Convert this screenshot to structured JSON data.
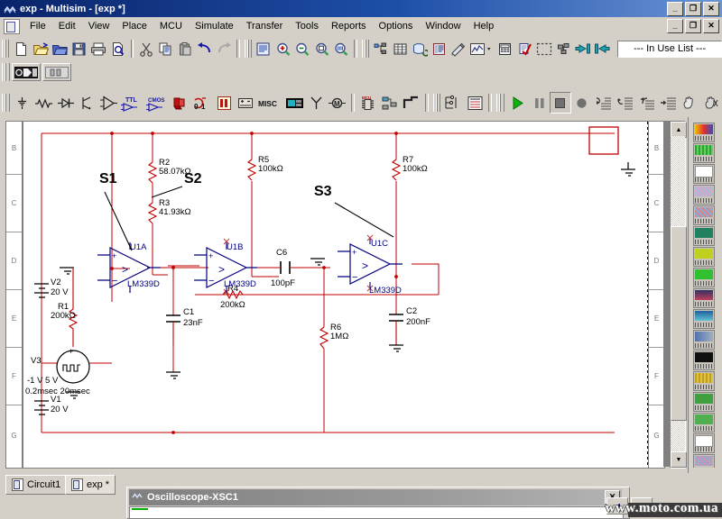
{
  "window": {
    "title": "exp - Multisim - [exp *]",
    "icon": "multisim-icon",
    "minimize": "_",
    "restore": "❐",
    "close": "✕"
  },
  "menu": {
    "items": [
      {
        "label": "File"
      },
      {
        "label": "Edit"
      },
      {
        "label": "View"
      },
      {
        "label": "Place"
      },
      {
        "label": "MCU"
      },
      {
        "label": "Simulate"
      },
      {
        "label": "Transfer"
      },
      {
        "label": "Tools"
      },
      {
        "label": "Reports"
      },
      {
        "label": "Options"
      },
      {
        "label": "Window"
      },
      {
        "label": "Help"
      }
    ],
    "minimize": "_",
    "restore": "❐",
    "close": "✕"
  },
  "toolbars": {
    "standard": [
      {
        "name": "new-file-icon"
      },
      {
        "name": "open-file-icon"
      },
      {
        "name": "open-design-icon"
      },
      {
        "name": "save-icon"
      },
      {
        "name": "print-icon"
      },
      {
        "name": "print-preview-icon"
      },
      {
        "name": "cut-icon"
      },
      {
        "name": "copy-icon"
      },
      {
        "name": "paste-icon"
      },
      {
        "name": "undo-icon"
      },
      {
        "name": "redo-icon"
      }
    ],
    "view": [
      {
        "name": "full-screen-icon"
      },
      {
        "name": "zoom-in-icon"
      },
      {
        "name": "zoom-out-icon"
      },
      {
        "name": "zoom-area-icon"
      },
      {
        "name": "zoom-fit-icon"
      }
    ],
    "main": [
      {
        "name": "design-toolbox-icon"
      },
      {
        "name": "spreadsheet-view-icon"
      },
      {
        "name": "database-icon"
      },
      {
        "name": "in-use-list-icon"
      },
      {
        "name": "component-wizard-icon"
      },
      {
        "name": "graphs-analyses-icon"
      },
      {
        "name": "postprocessor-icon"
      },
      {
        "name": "electrical-rules-check-icon"
      },
      {
        "name": "capture-screen-area-icon"
      },
      {
        "name": "back-annotate-icon"
      },
      {
        "name": "transfer-to-ultiboard-icon"
      }
    ],
    "in_use_list": "--- In Use List ---",
    "simulation_switch": [
      {
        "name": "simulation-switch-icon"
      },
      {
        "name": "pause-bar-icon"
      }
    ],
    "components": [
      {
        "name": "sources-icon",
        "label": ""
      },
      {
        "name": "basic-icon",
        "label": ""
      },
      {
        "name": "diodes-icon",
        "label": ""
      },
      {
        "name": "transistors-icon",
        "label": ""
      },
      {
        "name": "analog-icon",
        "label": ""
      },
      {
        "name": "ttl-icon",
        "label": "TTL"
      },
      {
        "name": "cmos-icon",
        "label": "CMOS"
      },
      {
        "name": "misc-digital-icon",
        "label": ""
      },
      {
        "name": "mixed-icon",
        "label": "0 1"
      },
      {
        "name": "indicators-icon",
        "label": ""
      },
      {
        "name": "power-icon",
        "label": ""
      },
      {
        "name": "misc-icon",
        "label": "MISC"
      },
      {
        "name": "advanced-peripherals-icon",
        "label": ""
      },
      {
        "name": "rf-icon",
        "label": ""
      },
      {
        "name": "electromechanical-icon",
        "label": ""
      },
      {
        "name": "mcu-module-icon",
        "label": ""
      },
      {
        "name": "hierarchical-block-icon",
        "label": ""
      },
      {
        "name": "bus-icon",
        "label": ""
      }
    ],
    "instruments": [
      {
        "name": "measurement-probe-icon"
      },
      {
        "name": "multimeter-icon"
      }
    ],
    "simulation": [
      {
        "name": "run-icon"
      },
      {
        "name": "pause-icon"
      },
      {
        "name": "stop-icon"
      },
      {
        "name": "record-icon"
      },
      {
        "name": "step-into-icon"
      },
      {
        "name": "step-over-icon"
      },
      {
        "name": "step-out-icon"
      },
      {
        "name": "run-to-cursor-icon"
      },
      {
        "name": "pause-hand-icon"
      },
      {
        "name": "stop-hand-icon"
      }
    ]
  },
  "ruler": {
    "rows": [
      "B",
      "C",
      "D",
      "E",
      "F",
      "G"
    ]
  },
  "scrollbar": {
    "up": "▲",
    "down": "▼"
  },
  "schematic": {
    "wire_color": "#c00000",
    "symbol_color": "#000080",
    "label_color": "#000000",
    "pin_color": "#8888cc",
    "components": [
      {
        "ref": "R2",
        "value": "58.07kΩ",
        "type": "resistor"
      },
      {
        "ref": "R3",
        "value": "41.93kΩ",
        "type": "resistor"
      },
      {
        "ref": "R5",
        "value": "100kΩ",
        "type": "resistor"
      },
      {
        "ref": "R7",
        "value": "100kΩ",
        "type": "resistor"
      },
      {
        "ref": "R1",
        "value": "200kΩ",
        "type": "resistor"
      },
      {
        "ref": "R4",
        "value": "200kΩ",
        "type": "resistor"
      },
      {
        "ref": "R6",
        "value": "1MΩ",
        "type": "resistor"
      },
      {
        "ref": "C1",
        "value": "23nF",
        "type": "capacitor"
      },
      {
        "ref": "C6",
        "value": "100pF",
        "type": "capacitor"
      },
      {
        "ref": "C2",
        "value": "200nF",
        "type": "capacitor"
      },
      {
        "ref": "V1",
        "value": "20 V",
        "type": "dc-source"
      },
      {
        "ref": "V2",
        "value": "20 V",
        "type": "dc-source"
      },
      {
        "ref": "V3",
        "value": "-1 V 5 V\n0.2msec 20msec",
        "type": "pulse-source"
      },
      {
        "ref": "U1A",
        "value": "LM339D",
        "type": "comparator"
      },
      {
        "ref": "U1B",
        "value": "LM339D",
        "type": "comparator"
      },
      {
        "ref": "U1C",
        "value": "LM339D",
        "type": "comparator"
      }
    ],
    "labels": {
      "S1": "S1",
      "S2": "S2",
      "S3": "S3",
      "R2_ref": "R2",
      "R2_val": "58.07kΩ",
      "R3_ref": "R3",
      "R3_val": "41.93kΩ",
      "R5_ref": "R5",
      "R5_val": "100kΩ",
      "R7_ref": "R7",
      "R7_val": "100kΩ",
      "R1_ref": "R1",
      "R1_val": "200kΩ",
      "R4_ref": "R4",
      "R4_val": "200kΩ",
      "R6_ref": "R6",
      "R6_val": "1MΩ",
      "C1_ref": "C1",
      "C1_val": "23nF",
      "C6_ref": "C6",
      "C6_val": "100pF",
      "C2_ref": "C2",
      "C2_val": "200nF",
      "V1_ref": "V1",
      "V1_val": "20 V",
      "V2_ref": "V2",
      "V2_val": "20 V",
      "V3_ref": "V3",
      "V3_line1": "-1 V 5 V",
      "V3_line2": "0.2msec 20msec",
      "U1A_ref": "U1A",
      "U1A_part": "LM339D",
      "U1B_ref": "U1B",
      "U1B_part": "LM339D",
      "U1C_ref": "U1C",
      "U1C_part": "LM339D"
    }
  },
  "palette": {
    "items": [
      {
        "name": "palette-item-1"
      },
      {
        "name": "palette-item-2"
      },
      {
        "name": "palette-item-3"
      },
      {
        "name": "palette-item-4"
      },
      {
        "name": "palette-item-5"
      },
      {
        "name": "palette-item-6"
      },
      {
        "name": "palette-item-7"
      },
      {
        "name": "palette-item-8"
      },
      {
        "name": "palette-item-9"
      },
      {
        "name": "palette-item-10"
      },
      {
        "name": "palette-item-11"
      },
      {
        "name": "palette-item-12"
      },
      {
        "name": "palette-item-13"
      },
      {
        "name": "palette-item-14"
      },
      {
        "name": "palette-item-15"
      },
      {
        "name": "palette-item-16"
      },
      {
        "name": "palette-item-17"
      },
      {
        "name": "palette-item-18"
      }
    ]
  },
  "tabs": [
    {
      "label": "Circuit1",
      "active": false
    },
    {
      "label": "exp *",
      "active": true
    }
  ],
  "oscilloscope": {
    "title": "Oscilloscope-XSC1",
    "close": "✕"
  },
  "nav": {
    "prev": "◀",
    "next": "▶"
  },
  "watermark": "www.moto.com.ua"
}
